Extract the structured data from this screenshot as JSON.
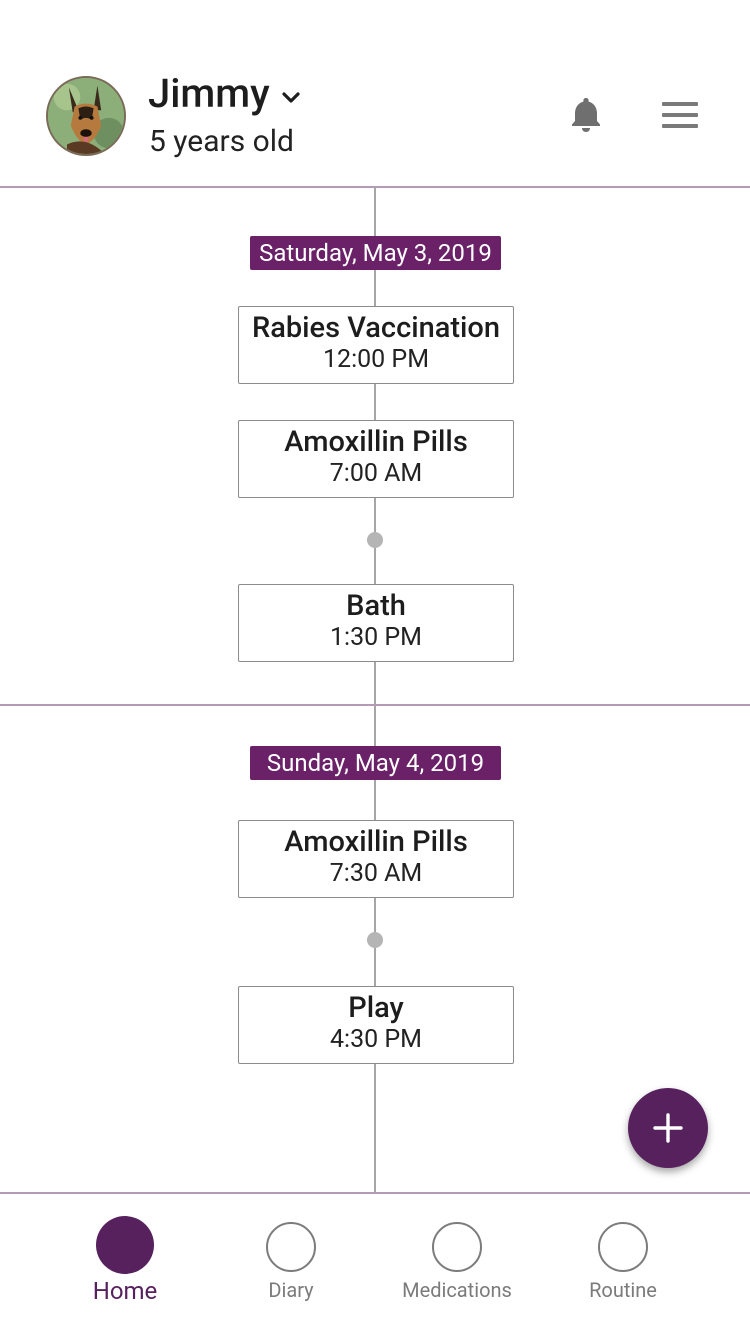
{
  "header": {
    "pet_name": "Jimmy",
    "pet_age": "5 years old"
  },
  "timeline": [
    {
      "date": "Saturday, May 3, 2019",
      "events": [
        {
          "title": "Rabies Vaccination",
          "time": "12:00 PM"
        },
        {
          "title": "Amoxillin Pills",
          "time": "7:00 AM"
        },
        {
          "title": "Bath",
          "time": "1:30 PM"
        }
      ]
    },
    {
      "date": "Sunday, May 4, 2019",
      "events": [
        {
          "title": "Amoxillin Pills",
          "time": "7:30 AM"
        },
        {
          "title": "Play",
          "time": "4:30 PM"
        }
      ]
    }
  ],
  "bottom_nav": {
    "items": [
      {
        "label": "Home",
        "active": true
      },
      {
        "label": "Diary",
        "active": false
      },
      {
        "label": "Medications",
        "active": false
      },
      {
        "label": "Routine",
        "active": false
      }
    ]
  },
  "colors": {
    "accent": "#57215e",
    "date_badge": "#6a2168",
    "divider": "#b59ab8"
  }
}
